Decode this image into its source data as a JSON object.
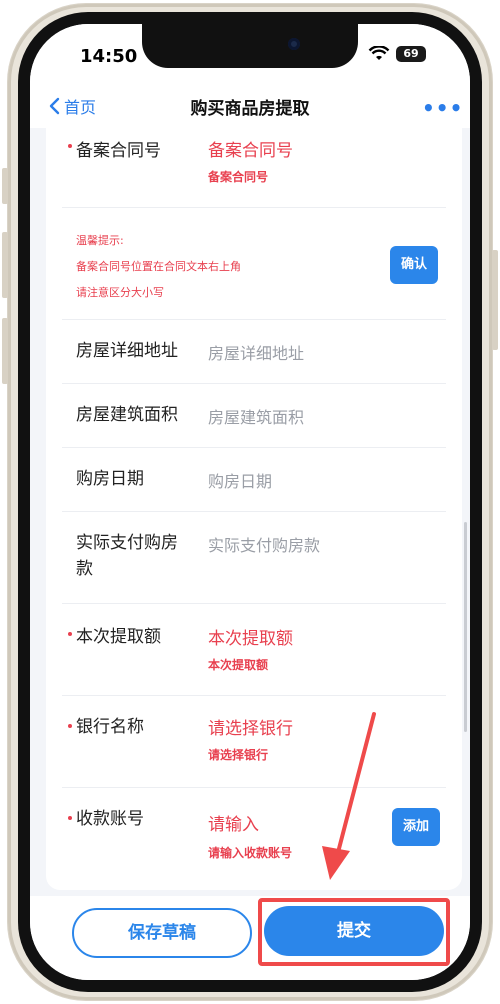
{
  "status_bar": {
    "time": "14:50",
    "battery": "69"
  },
  "nav": {
    "back_label": "首页",
    "title": "购买商品房提取",
    "more_icon": "more-dots-icon"
  },
  "form": {
    "contract": {
      "label": "备案合同号",
      "value": "备案合同号",
      "error": "备案合同号"
    },
    "tips": {
      "title": "温馨提示:",
      "line1": "备案合同号位置在合同文本右上角",
      "line2": "请注意区分大小写",
      "confirm_label": "确认"
    },
    "address": {
      "label": "房屋详细地址",
      "placeholder": "房屋详细地址"
    },
    "area": {
      "label": "房屋建筑面积",
      "placeholder": "房屋建筑面积"
    },
    "date": {
      "label": "购房日期",
      "placeholder": "购房日期"
    },
    "paid": {
      "label_line1": "实际支付购房",
      "label_line2": "款",
      "placeholder": "实际支付购房款"
    },
    "amount": {
      "label": "本次提取额",
      "value": "本次提取额",
      "error": "本次提取额"
    },
    "bank": {
      "label": "银行名称",
      "value": "请选择银行",
      "error": "请选择银行"
    },
    "account": {
      "label": "收款账号",
      "value": "请输入",
      "error": "请输入收款账号",
      "add_label": "添加"
    }
  },
  "footer": {
    "draft_label": "保存草稿",
    "submit_label": "提交"
  },
  "colors": {
    "accent": "#2b86ea",
    "error": "#e8404f",
    "highlight": "#ef4a4a"
  }
}
